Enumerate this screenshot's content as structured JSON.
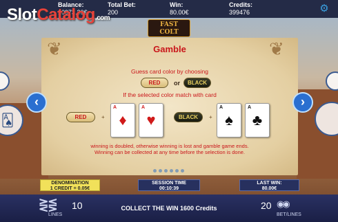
{
  "top": {
    "balance_label": "Balance:",
    "balance_value": "10973.30€",
    "total_bet_label": "Total Bet:",
    "total_bet_value": "200",
    "win_label": "Win:",
    "win_value": "80.00€",
    "credits_label": "Credits:",
    "credits_value": "399476",
    "settings_icon": "gear-icon"
  },
  "watermark": {
    "part1": "Slot",
    "part2": "Catalog",
    "suffix": ".com"
  },
  "game_logo": {
    "line1": "FAST",
    "line2": "COLT"
  },
  "gamble": {
    "title": "Gamble",
    "instruction1": "Guess card color by choosing",
    "or_label": "or",
    "instruction2": "If the selected color match with card",
    "red_label": "RED",
    "black_label": "BLACK",
    "plus": "+",
    "cards": [
      {
        "rank": "A",
        "suit": "♦",
        "color": "red"
      },
      {
        "rank": "A",
        "suit": "♥",
        "color": "red"
      },
      {
        "rank": "A",
        "suit": "♠",
        "color": "black"
      },
      {
        "rank": "A",
        "suit": "♣",
        "color": "black"
      }
    ],
    "desc1": "winning is doubled, otherwise winning is lost and gamble game ends.",
    "desc2": "Winning can be collected at any time before the selection is done."
  },
  "info": {
    "denomination_label": "DENOMINATION",
    "denomination_value": "1 CREDIT = 0.05€",
    "session_label": "SESSION TIME",
    "session_value": "00:10:39",
    "last_win_label": "LAST WIN:",
    "last_win_value": "80.00€"
  },
  "bottom": {
    "lines_value": "10",
    "lines_label": "LINES",
    "collect_text": "COLLECT THE WIN 1600 Credits",
    "bet_value": "20",
    "bet_label": "BET/LINES"
  },
  "colors": {
    "accent_red": "#c9151a",
    "bar_navy": "#27305e",
    "denom_yellow": "#f1e15a",
    "arrow_blue": "#2a6fd0"
  }
}
